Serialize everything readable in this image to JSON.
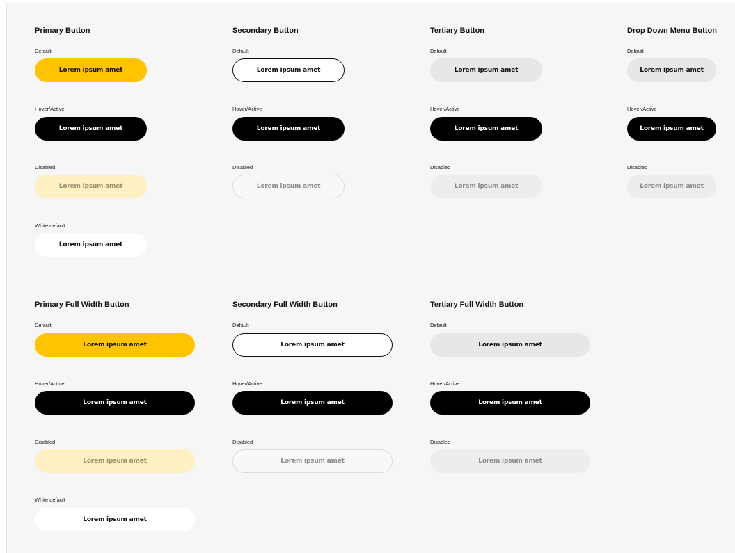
{
  "colors": {
    "page_background": "#f5f6f5",
    "primary_yellow": "#ffc300",
    "primary_disabled": "#fff0c4",
    "black": "#000000",
    "tertiary_gray": "#e6e7e8",
    "white": "#ffffff"
  },
  "button_label": "Lorem ipsum amet",
  "states": {
    "default": "Default",
    "hover": "Hover/Active",
    "disabled": "Disabled",
    "white_default": "White default"
  },
  "sections": {
    "primary": {
      "title": "Primary Button"
    },
    "secondary": {
      "title": "Secondary Button"
    },
    "tertiary": {
      "title": "Tertiary Button"
    },
    "dropdown": {
      "title": "Drop Down Menu Button"
    },
    "primary_full": {
      "title": "Primary Full Width Button"
    },
    "secondary_full": {
      "title": "Secondary Full Width Button"
    },
    "tertiary_full": {
      "title": "Tertiary Full Width Button"
    }
  }
}
